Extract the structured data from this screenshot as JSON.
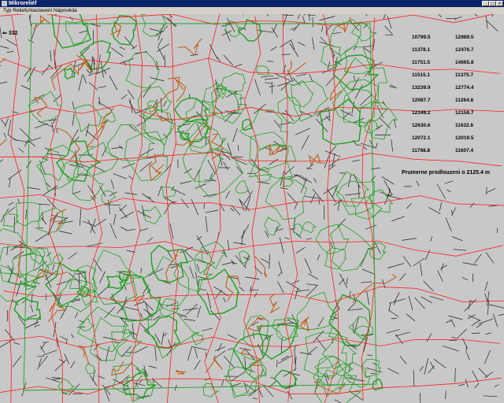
{
  "window": {
    "title": "Mikroreliéf",
    "icon": "app-icon",
    "controls": {
      "minimize": "_",
      "maximize": "□",
      "close": "×"
    }
  },
  "menu": {
    "items": [
      "Typ Reliefu",
      "Nastavení",
      "Nápověda"
    ]
  },
  "map": {
    "selected_count_label": "332",
    "cursor_icon": "arrow-icon",
    "colors": {
      "background": "#c8c8c8",
      "ridge_lines": "#ff2020",
      "contours": "#20a020",
      "drainage": "#202020",
      "valleys": "#c06020"
    }
  },
  "results": {
    "rows": [
      [
        "10799.5",
        "12989.5"
      ],
      [
        "11378.1",
        "12476.7"
      ],
      [
        "11751.5",
        "14665.8"
      ],
      [
        "11515.1",
        "11375.7"
      ],
      [
        "13239.9",
        "12774.4"
      ],
      [
        "12087.7",
        "11264.8"
      ],
      [
        "12349.2",
        "12158.7"
      ],
      [
        "12630.6",
        "11632.6"
      ],
      [
        "12072.1",
        "12019.5"
      ],
      [
        "11798.8",
        "11607.4"
      ]
    ],
    "average_label": "Prumerne prodlouzeni o 2125.4 m"
  }
}
